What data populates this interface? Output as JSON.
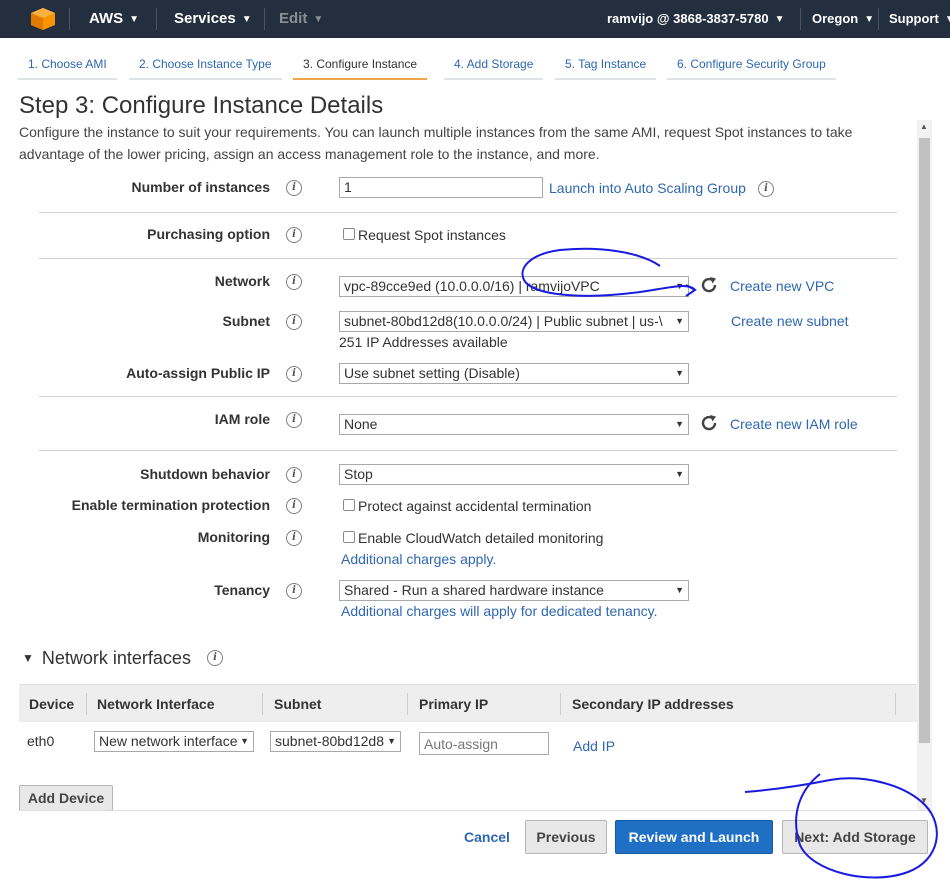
{
  "nav": {
    "aws": "AWS",
    "services": "Services",
    "edit": "Edit",
    "account": "ramvijo @ 3868-3837-5780",
    "region": "Oregon",
    "support": "Support"
  },
  "steps": [
    {
      "label": "1. Choose AMI"
    },
    {
      "label": "2. Choose Instance Type"
    },
    {
      "label": "3. Configure Instance"
    },
    {
      "label": "4. Add Storage"
    },
    {
      "label": "5. Tag Instance"
    },
    {
      "label": "6. Configure Security Group"
    }
  ],
  "page": {
    "title": "Step 3: Configure Instance Details",
    "description": "Configure the instance to suit your requirements. You can launch multiple instances from the same AMI, request Spot instances to take advantage of the lower pricing, assign an access management role to the instance, and more."
  },
  "form": {
    "num_instances_label": "Number of instances",
    "num_instances_value": "1",
    "auto_scaling_link": "Launch into Auto Scaling Group",
    "purchasing_label": "Purchasing option",
    "spot_label": "Request Spot instances",
    "network_label": "Network",
    "network_value": "vpc-89cce9ed (10.0.0.0/16) | ramvijoVPC",
    "create_vpc_link": "Create new VPC",
    "subnet_label": "Subnet",
    "subnet_value": "subnet-80bd12d8(10.0.0.0/24) | Public subnet | us-\\",
    "create_subnet_link": "Create new subnet",
    "ip_available": "251 IP Addresses available",
    "public_ip_label": "Auto-assign Public IP",
    "public_ip_value": "Use subnet setting (Disable)",
    "iam_label": "IAM role",
    "iam_value": "None",
    "create_iam_link": "Create new IAM role",
    "shutdown_label": "Shutdown behavior",
    "shutdown_value": "Stop",
    "termination_label": "Enable termination protection",
    "termination_check_label": "Protect against accidental termination",
    "monitoring_label": "Monitoring",
    "monitoring_check_label": "Enable CloudWatch detailed monitoring",
    "monitoring_charges": "Additional charges apply.",
    "tenancy_label": "Tenancy",
    "tenancy_value": "Shared - Run a shared hardware instance",
    "tenancy_charges": "Additional charges will apply for dedicated tenancy."
  },
  "network_interfaces": {
    "title": "Network interfaces",
    "columns": [
      "Device",
      "Network Interface",
      "Subnet",
      "Primary IP",
      "Secondary IP addresses"
    ],
    "row": {
      "device": "eth0",
      "interface": "New network interface",
      "subnet": "subnet-80bd12d8",
      "primary_ip_placeholder": "Auto-assign",
      "add_ip": "Add IP"
    },
    "add_device": "Add Device"
  },
  "footer": {
    "cancel": "Cancel",
    "previous": "Previous",
    "review_launch": "Review and Launch",
    "next": "Next: Add Storage"
  },
  "colors": {
    "nav_bg": "#232f3e",
    "link": "#2e67b1",
    "primary_button": "#1f6fc5",
    "active_tab": "#f0a44b",
    "annotation": "#1a1adf"
  }
}
